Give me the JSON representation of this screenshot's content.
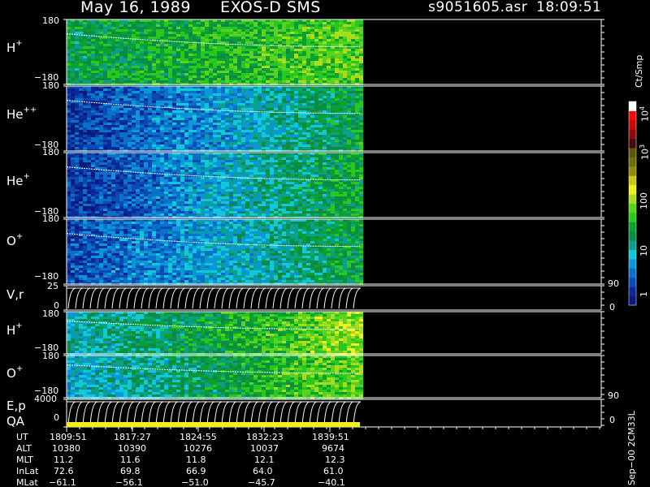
{
  "header": {
    "date": "May 16, 1989",
    "instrument": "EXOS-D SMS",
    "file": "s9051605.asr",
    "time": "18:09:51"
  },
  "panels": [
    {
      "name": "H",
      "sup": "+",
      "ymax": "180",
      "ymin": "−180"
    },
    {
      "name": "He",
      "sup": "++",
      "ymax": "180",
      "ymin": "−180"
    },
    {
      "name": "He",
      "sup": "+",
      "ymax": "180",
      "ymin": "−180"
    },
    {
      "name": "O",
      "sup": "+",
      "ymax": "180",
      "ymin": "−180"
    },
    {
      "name": "V,r",
      "ymax": "25",
      "ymin": "0",
      "rmax": "90",
      "rmin": "0"
    },
    {
      "name": "H",
      "sup": "+",
      "ymax": "180",
      "ymin": "−180"
    },
    {
      "name": "O",
      "sup": "+",
      "ymax": "180",
      "ymin": "−180"
    },
    {
      "name": "E,p",
      "name2": "QA",
      "ymax": "4000",
      "ymin": "0",
      "rmax": "90",
      "rmin": "0"
    }
  ],
  "colorbar": {
    "unit": "Ct/Smp",
    "labels": [
      {
        "text": "10",
        "sup": "4",
        "value": 10000
      },
      {
        "text": "10",
        "sup": "3",
        "value": 1000
      },
      {
        "text": "100",
        "value": 100
      },
      {
        "text": "10",
        "value": 10
      },
      {
        "text": "1",
        "value": 1
      }
    ],
    "colors": [
      "#0a1a7a",
      "#0a2a9a",
      "#0a4ab4",
      "#0a70c8",
      "#0a96d8",
      "#10c8d8",
      "#0aa08c",
      "#0a8c46",
      "#0aa032",
      "#28c81e",
      "#5ad21e",
      "#aadc1e",
      "#f0f01e",
      "#c8c814",
      "#8c8c0a",
      "#6e6e0a",
      "#5a5a0a",
      "#460a0a",
      "#8c0a0a",
      "#c80a0a",
      "#f00a0a",
      "#ffffff"
    ]
  },
  "footer": {
    "row_labels": [
      "UT",
      "ALT",
      "MLT",
      "InLat",
      "MLat"
    ],
    "columns": [
      [
        "1809:51",
        "10380",
        "11.2",
        "72.6",
        "−61.1"
      ],
      [
        "1817:27",
        "10390",
        "11.6",
        "69.8",
        "−56.1"
      ],
      [
        "1824:55",
        "10276",
        "11.8",
        "66.9",
        "−51.0"
      ],
      [
        "1832:23",
        "10037",
        "12.1",
        "64.0",
        "−45.7"
      ],
      [
        "1839:51",
        "9674",
        "12.3",
        "61.0",
        "−40.1"
      ]
    ],
    "version": "Sep−00 2CM33L"
  },
  "chart_data": {
    "type": "heatmap",
    "title": "May 16, 1989   EXOS-D SMS",
    "x_ticks": [
      "1809:51",
      "1817:27",
      "1824:55",
      "1832:23",
      "1839:51"
    ],
    "colorbar_range": [
      1,
      10000
    ],
    "colorbar_scale": "log",
    "series": [
      {
        "name": "H+",
        "ylim": [
          -180,
          180
        ],
        "intensity_profile": [
          0.55,
          0.6,
          0.65,
          0.7,
          0.75
        ]
      },
      {
        "name": "He++",
        "ylim": [
          -180,
          180
        ],
        "intensity_profile": [
          0.1,
          0.2,
          0.3,
          0.45,
          0.6
        ]
      },
      {
        "name": "He+",
        "ylim": [
          -180,
          180
        ],
        "intensity_profile": [
          0.1,
          0.2,
          0.35,
          0.5,
          0.6
        ]
      },
      {
        "name": "O+",
        "ylim": [
          -180,
          180
        ],
        "intensity_profile": [
          0.15,
          0.25,
          0.35,
          0.45,
          0.6
        ]
      },
      {
        "name": "V,r",
        "ylim": [
          0,
          25
        ]
      },
      {
        "name": "H+",
        "ylim": [
          -180,
          180
        ],
        "intensity_profile": [
          0.4,
          0.5,
          0.6,
          0.7,
          0.85
        ]
      },
      {
        "name": "O+",
        "ylim": [
          -180,
          180
        ],
        "intensity_profile": [
          0.35,
          0.45,
          0.55,
          0.7,
          0.75
        ]
      },
      {
        "name": "E,p",
        "ylim": [
          0,
          4000
        ]
      }
    ]
  }
}
